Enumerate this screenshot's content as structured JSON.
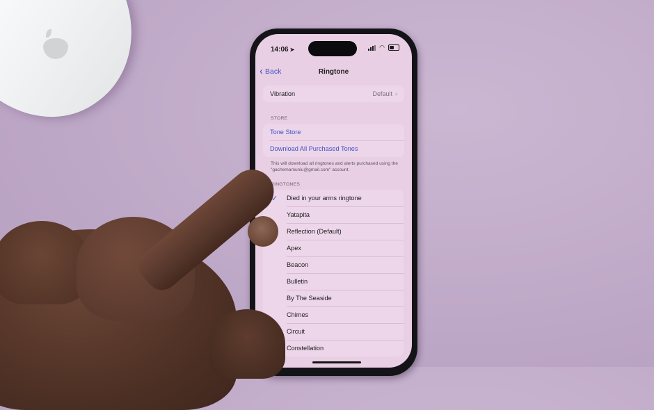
{
  "status_bar": {
    "time": "14:06",
    "location_icon": "location-arrow-icon",
    "signal_icon": "cellular-signal-icon",
    "wifi_icon": "wifi-icon",
    "battery_icon": "battery-icon"
  },
  "nav": {
    "back_label": "Back",
    "back_icon": "chevron-left-icon",
    "title": "Ringtone"
  },
  "vibration": {
    "label": "Vibration",
    "value": "Default",
    "chevron": "›"
  },
  "store": {
    "header": "STORE",
    "tone_store": "Tone Store",
    "download_all": "Download All Purchased Tones",
    "footer": "This will download all ringtones and alerts purchased using the \"gachemamuniu@gmail.com\" account."
  },
  "ringtones": {
    "header": "RINGTONES",
    "check_glyph": "✓",
    "items": [
      {
        "label": "Died in your arms ringtone",
        "selected": true
      },
      {
        "label": "Yatapita",
        "selected": false
      },
      {
        "label": "Reflection (Default)",
        "selected": false
      },
      {
        "label": "Apex",
        "selected": false
      },
      {
        "label": "Beacon",
        "selected": false
      },
      {
        "label": "Bulletin",
        "selected": false
      },
      {
        "label": "By The Seaside",
        "selected": false
      },
      {
        "label": "Chimes",
        "selected": false
      },
      {
        "label": "Circuit",
        "selected": false
      },
      {
        "label": "Constellation",
        "selected": false
      }
    ]
  },
  "colors": {
    "accent": "#3e52c5",
    "screen_bg": "#e9cfe3",
    "group_bg": "#edd6e9",
    "desk_bg": "#c3aecb"
  }
}
